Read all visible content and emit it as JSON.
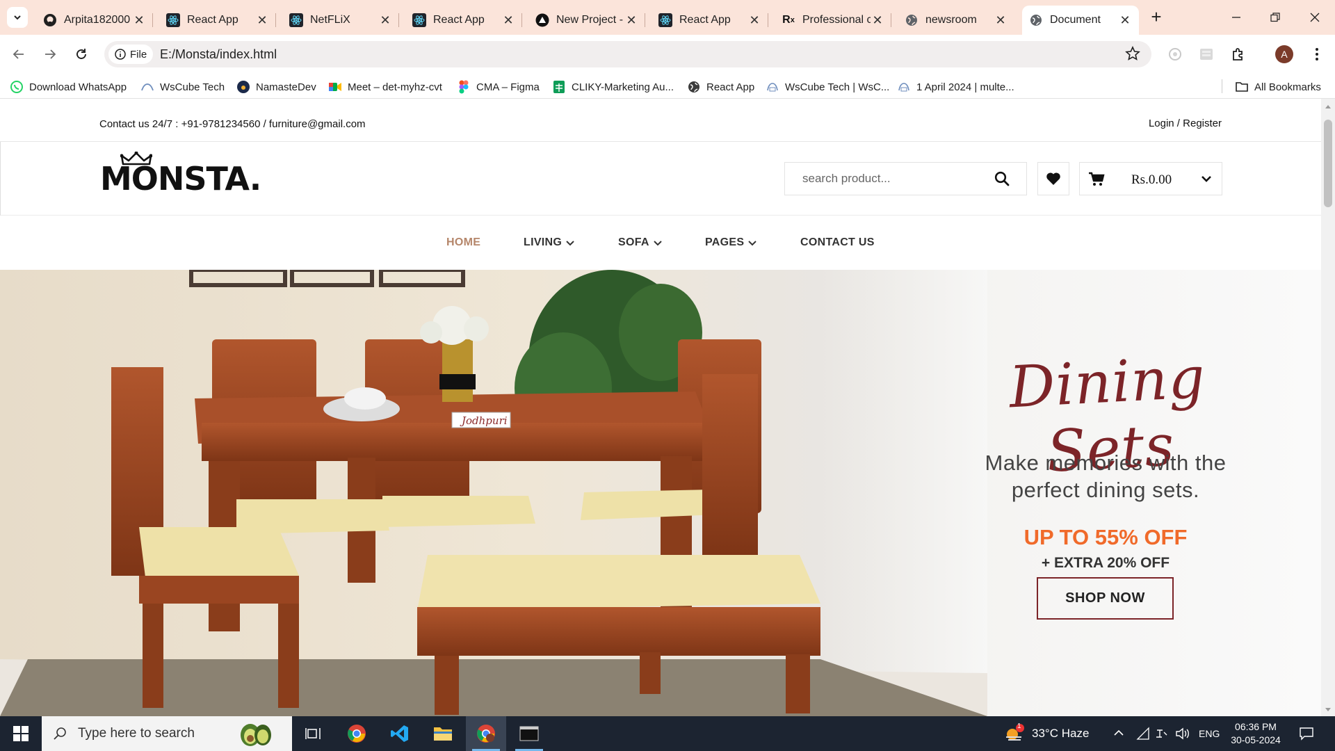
{
  "browser": {
    "tabs": [
      {
        "title": "Arpita182000",
        "icon": "github-icon"
      },
      {
        "title": "React App",
        "icon": "react-icon"
      },
      {
        "title": "NetFLiX",
        "icon": "react-icon"
      },
      {
        "title": "React App",
        "icon": "react-icon"
      },
      {
        "title": "New Project -",
        "icon": "vercel-icon"
      },
      {
        "title": "React App",
        "icon": "react-icon"
      },
      {
        "title": "Professional c",
        "icon": "rx-icon"
      },
      {
        "title": "newsroom",
        "icon": "globe-icon"
      },
      {
        "title": "Document",
        "icon": "globe-icon",
        "active": true
      }
    ],
    "url_chip": "File",
    "url": "E:/Monsta/index.html",
    "avatar_letter": "A",
    "bookmarks": [
      "Download WhatsApp",
      "WsCube Tech",
      "NamasteDev",
      "Meet – det-myhz-cvt",
      "CMA – Figma",
      "CLIKY-Marketing Au...",
      "React App",
      "WsCube Tech | WsC...",
      "1 April 2024 | multe..."
    ],
    "all_bookmarks": "All Bookmarks"
  },
  "site": {
    "contact": "Contact us 24/7 : +91-9781234560 / furniture@gmail.com",
    "login": "Login / Register",
    "logo": "MONSTA.",
    "search_placeholder": "search product...",
    "cart_total": "Rs.0.00",
    "nav": [
      "HOME",
      "LIVING",
      "SOFA",
      "PAGES",
      "CONTACT US"
    ],
    "nav_active_color": "#b5866a",
    "hero": {
      "title": "Dining Sets",
      "subtitle_line1": "Make memories with the",
      "subtitle_line2": "perfect dining sets.",
      "offer": "UP TO 55% OFF",
      "extra": "+ EXTRA 20% OFF",
      "button": "SHOP NOW",
      "brand_tag": "Jodhpuri"
    }
  },
  "taskbar": {
    "search_placeholder": "Type here to search",
    "weather": "33°C  Haze",
    "weather_badge": "1",
    "language": "ENG",
    "time": "06:36 PM",
    "date": "30-05-2024"
  },
  "colors": {
    "accent_maroon": "#7c2428",
    "offer_orange": "#f06a2a",
    "tabstrip": "#fbe4da"
  }
}
